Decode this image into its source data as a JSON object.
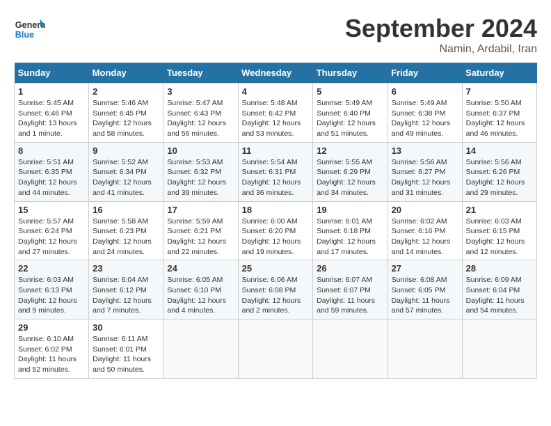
{
  "header": {
    "logo_general": "General",
    "logo_blue": "Blue",
    "month_title": "September 2024",
    "location": "Namin, Ardabil, Iran"
  },
  "weekdays": [
    "Sunday",
    "Monday",
    "Tuesday",
    "Wednesday",
    "Thursday",
    "Friday",
    "Saturday"
  ],
  "weeks": [
    [
      {
        "day": "1",
        "info": "Sunrise: 5:45 AM\nSunset: 6:46 PM\nDaylight: 13 hours\nand 1 minute."
      },
      {
        "day": "2",
        "info": "Sunrise: 5:46 AM\nSunset: 6:45 PM\nDaylight: 12 hours\nand 58 minutes."
      },
      {
        "day": "3",
        "info": "Sunrise: 5:47 AM\nSunset: 6:43 PM\nDaylight: 12 hours\nand 56 minutes."
      },
      {
        "day": "4",
        "info": "Sunrise: 5:48 AM\nSunset: 6:42 PM\nDaylight: 12 hours\nand 53 minutes."
      },
      {
        "day": "5",
        "info": "Sunrise: 5:49 AM\nSunset: 6:40 PM\nDaylight: 12 hours\nand 51 minutes."
      },
      {
        "day": "6",
        "info": "Sunrise: 5:49 AM\nSunset: 6:38 PM\nDaylight: 12 hours\nand 49 minutes."
      },
      {
        "day": "7",
        "info": "Sunrise: 5:50 AM\nSunset: 6:37 PM\nDaylight: 12 hours\nand 46 minutes."
      }
    ],
    [
      {
        "day": "8",
        "info": "Sunrise: 5:51 AM\nSunset: 6:35 PM\nDaylight: 12 hours\nand 44 minutes."
      },
      {
        "day": "9",
        "info": "Sunrise: 5:52 AM\nSunset: 6:34 PM\nDaylight: 12 hours\nand 41 minutes."
      },
      {
        "day": "10",
        "info": "Sunrise: 5:53 AM\nSunset: 6:32 PM\nDaylight: 12 hours\nand 39 minutes."
      },
      {
        "day": "11",
        "info": "Sunrise: 5:54 AM\nSunset: 6:31 PM\nDaylight: 12 hours\nand 36 minutes."
      },
      {
        "day": "12",
        "info": "Sunrise: 5:55 AM\nSunset: 6:29 PM\nDaylight: 12 hours\nand 34 minutes."
      },
      {
        "day": "13",
        "info": "Sunrise: 5:56 AM\nSunset: 6:27 PM\nDaylight: 12 hours\nand 31 minutes."
      },
      {
        "day": "14",
        "info": "Sunrise: 5:56 AM\nSunset: 6:26 PM\nDaylight: 12 hours\nand 29 minutes."
      }
    ],
    [
      {
        "day": "15",
        "info": "Sunrise: 5:57 AM\nSunset: 6:24 PM\nDaylight: 12 hours\nand 27 minutes."
      },
      {
        "day": "16",
        "info": "Sunrise: 5:58 AM\nSunset: 6:23 PM\nDaylight: 12 hours\nand 24 minutes."
      },
      {
        "day": "17",
        "info": "Sunrise: 5:59 AM\nSunset: 6:21 PM\nDaylight: 12 hours\nand 22 minutes."
      },
      {
        "day": "18",
        "info": "Sunrise: 6:00 AM\nSunset: 6:20 PM\nDaylight: 12 hours\nand 19 minutes."
      },
      {
        "day": "19",
        "info": "Sunrise: 6:01 AM\nSunset: 6:18 PM\nDaylight: 12 hours\nand 17 minutes."
      },
      {
        "day": "20",
        "info": "Sunrise: 6:02 AM\nSunset: 6:16 PM\nDaylight: 12 hours\nand 14 minutes."
      },
      {
        "day": "21",
        "info": "Sunrise: 6:03 AM\nSunset: 6:15 PM\nDaylight: 12 hours\nand 12 minutes."
      }
    ],
    [
      {
        "day": "22",
        "info": "Sunrise: 6:03 AM\nSunset: 6:13 PM\nDaylight: 12 hours\nand 9 minutes."
      },
      {
        "day": "23",
        "info": "Sunrise: 6:04 AM\nSunset: 6:12 PM\nDaylight: 12 hours\nand 7 minutes."
      },
      {
        "day": "24",
        "info": "Sunrise: 6:05 AM\nSunset: 6:10 PM\nDaylight: 12 hours\nand 4 minutes."
      },
      {
        "day": "25",
        "info": "Sunrise: 6:06 AM\nSunset: 6:08 PM\nDaylight: 12 hours\nand 2 minutes."
      },
      {
        "day": "26",
        "info": "Sunrise: 6:07 AM\nSunset: 6:07 PM\nDaylight: 11 hours\nand 59 minutes."
      },
      {
        "day": "27",
        "info": "Sunrise: 6:08 AM\nSunset: 6:05 PM\nDaylight: 11 hours\nand 57 minutes."
      },
      {
        "day": "28",
        "info": "Sunrise: 6:09 AM\nSunset: 6:04 PM\nDaylight: 11 hours\nand 54 minutes."
      }
    ],
    [
      {
        "day": "29",
        "info": "Sunrise: 6:10 AM\nSunset: 6:02 PM\nDaylight: 11 hours\nand 52 minutes."
      },
      {
        "day": "30",
        "info": "Sunrise: 6:11 AM\nSunset: 6:01 PM\nDaylight: 11 hours\nand 50 minutes."
      },
      {
        "day": "",
        "info": ""
      },
      {
        "day": "",
        "info": ""
      },
      {
        "day": "",
        "info": ""
      },
      {
        "day": "",
        "info": ""
      },
      {
        "day": "",
        "info": ""
      }
    ]
  ]
}
